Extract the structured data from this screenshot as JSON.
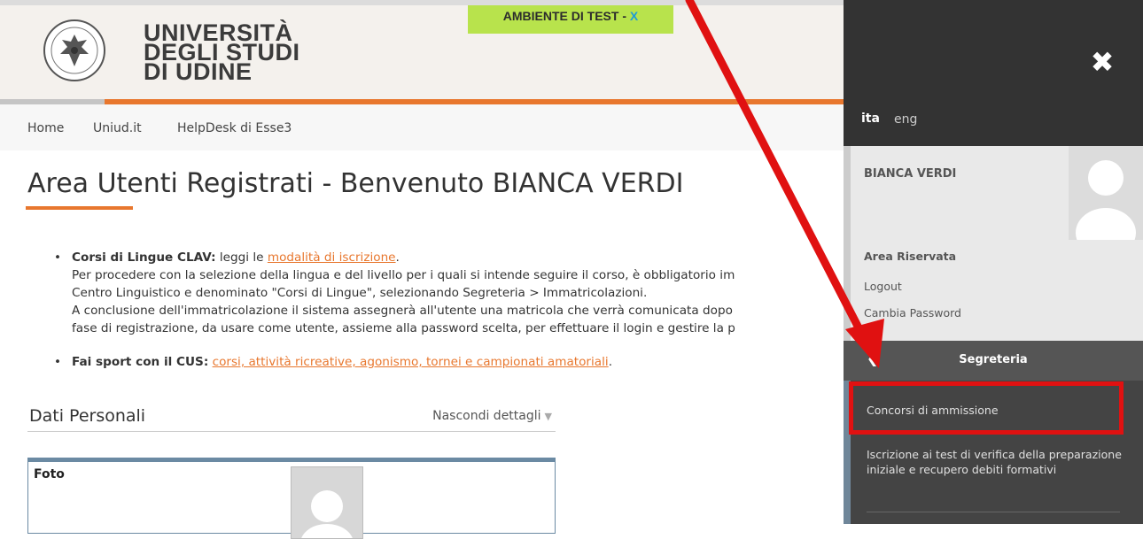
{
  "header": {
    "logo_line1": "UNIVERSITÀ",
    "logo_line2": "DEGLI STUDI",
    "logo_line3": "DI UDINE",
    "test_banner": "AMBIENTE DI TEST - ",
    "test_banner_close": "X"
  },
  "nav": {
    "items": [
      {
        "label": "Home"
      },
      {
        "label": "Uniud.it"
      },
      {
        "label": "HelpDesk di Esse3"
      }
    ]
  },
  "main": {
    "title": "Area Utenti Registrati - Benvenuto BIANCA VERDI",
    "bullet1": {
      "bold": "Corsi di Lingue CLAV:",
      "text": " leggi le ",
      "link": "modalità di iscrizione",
      "after": ".",
      "line2": "Per procedere con la selezione della lingua e del livello per i quali si intende seguire il corso, è obbligatorio im",
      "line3": "Centro Linguistico e denominato \"Corsi di Lingue\", selezionando Segreteria > Immatricolazioni.",
      "line4": "A conclusione dell'immatricolazione il sistema assegnerà all'utente una matricola che verrà comunicata dopo",
      "line5": "fase di registrazione, da usare come utente, assieme alla password scelta, per effettuare il login e gestire la p"
    },
    "bullet2": {
      "bold": "Fai sport con il CUS:",
      "link": "corsi, attività ricreative, agonismo, tornei e campionati amatoriali",
      "after": "."
    },
    "dati_personali": {
      "title": "Dati Personali",
      "toggle": "Nascondi dettagli",
      "foto_label": "Foto"
    }
  },
  "side": {
    "close_icon": "close-icon",
    "lang_active": "ita",
    "lang_other": "eng",
    "user_name": "BIANCA VERDI",
    "area_riservata": "Area Riservata",
    "logout": "Logout",
    "cambia_password": "Cambia Password",
    "section_title": "Segreteria",
    "menu": [
      {
        "label": "Concorsi di ammissione"
      },
      {
        "label": "Iscrizione ai test di verifica della preparazione iniziale e recupero debiti formativi"
      }
    ]
  },
  "colors": {
    "accent_orange": "#e8772e",
    "test_banner_green": "#b8e34c",
    "highlight_red": "#e01111",
    "side_panel_dark": "#333333"
  }
}
